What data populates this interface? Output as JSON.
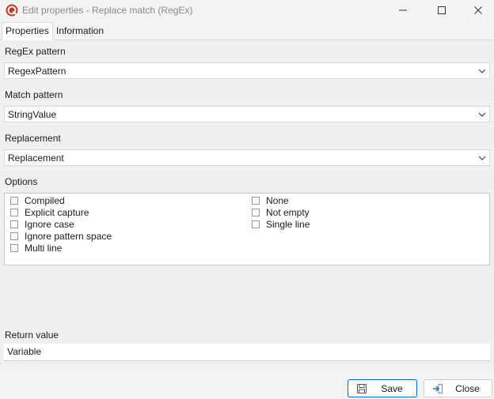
{
  "window": {
    "title": "Edit properties - Replace match (RegEx)",
    "minimize_icon": "minimize-icon",
    "maximize_icon": "maximize-icon",
    "close_icon": "close-icon"
  },
  "tabs": [
    {
      "label": "Properties",
      "active": true
    },
    {
      "label": "Information",
      "active": false
    }
  ],
  "fields": {
    "regex_pattern": {
      "label": "RegEx pattern",
      "value": "RegexPattern"
    },
    "match_pattern": {
      "label": "Match pattern",
      "value": "StringValue"
    },
    "replacement": {
      "label": "Replacement",
      "value": "Replacement"
    }
  },
  "options": {
    "label": "Options",
    "left": [
      {
        "label": "Compiled",
        "checked": false
      },
      {
        "label": "Explicit capture",
        "checked": false
      },
      {
        "label": "Ignore case",
        "checked": false
      },
      {
        "label": "Ignore pattern space",
        "checked": false
      },
      {
        "label": "Multi line",
        "checked": false
      }
    ],
    "right": [
      {
        "label": "None",
        "checked": false
      },
      {
        "label": "Not empty",
        "checked": false
      },
      {
        "label": "Single line",
        "checked": false
      }
    ]
  },
  "return_value": {
    "label": "Return value",
    "value": "Variable"
  },
  "buttons": {
    "save": "Save",
    "close": "Close"
  },
  "colors": {
    "accent": "#0067c0",
    "app_icon": "#c0392b"
  }
}
